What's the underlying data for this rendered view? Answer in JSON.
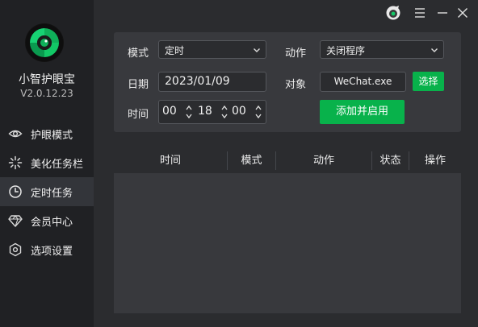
{
  "app": {
    "name": "小智护眼宝",
    "version": "V2.0.12.23"
  },
  "nav": {
    "items": [
      {
        "label": "护眼模式",
        "icon": "eye-icon"
      },
      {
        "label": "美化任务栏",
        "icon": "sparkle-icon"
      },
      {
        "label": "定时任务",
        "icon": "clock-icon"
      },
      {
        "label": "会员中心",
        "icon": "diamond-icon"
      },
      {
        "label": "选项设置",
        "icon": "hexagon-settings-icon"
      }
    ],
    "active_index": 2
  },
  "window_controls": [
    "skin-icon",
    "menu-icon",
    "minimize-icon",
    "close-icon"
  ],
  "form": {
    "mode_label": "模式",
    "mode_value": "定时",
    "action_label": "动作",
    "action_value": "关闭程序",
    "date_label": "日期",
    "date_value": "2023/01/09",
    "target_label": "对象",
    "target_value": "WeChat.exe",
    "choose_button": "选择",
    "time_label": "时间",
    "time_hour": "00",
    "time_minute": "18",
    "time_second": "00",
    "add_button": "添加并启用"
  },
  "table": {
    "columns": [
      "时间",
      "模式",
      "动作",
      "状态",
      "操作"
    ],
    "rows": []
  },
  "colors": {
    "accent_green": "#08b24b",
    "sidebar_bg": "#202124",
    "main_bg": "#2b2c2f",
    "panel_bg": "#38393d"
  }
}
